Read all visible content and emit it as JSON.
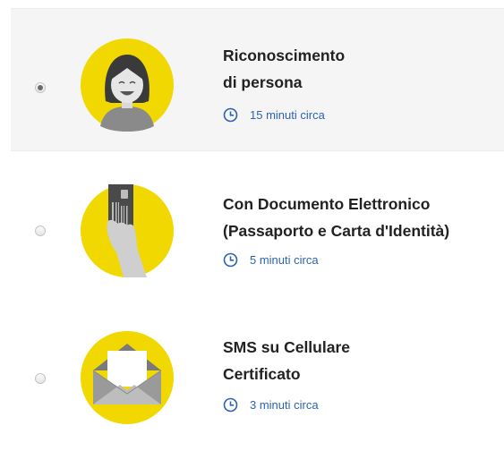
{
  "options": [
    {
      "title_line1": "Riconoscimento",
      "title_line2": "di persona",
      "time": "15 minuti circa",
      "selected": true,
      "icon": "person-icon"
    },
    {
      "title_line1": "Con Documento Elettronico",
      "title_line2": "(Passaporto e Carta d'Identità)",
      "time": "5 minuti circa",
      "selected": false,
      "icon": "card-in-hand-icon"
    },
    {
      "title_line1": "SMS su Cellulare",
      "title_line2": "Certificato",
      "time": "3 minuti circa",
      "selected": false,
      "icon": "envelope-icon"
    }
  ],
  "colors": {
    "accent_yellow": "#f0d800",
    "link_blue": "#2d63b0",
    "selected_bg": "#f5f5f5"
  }
}
